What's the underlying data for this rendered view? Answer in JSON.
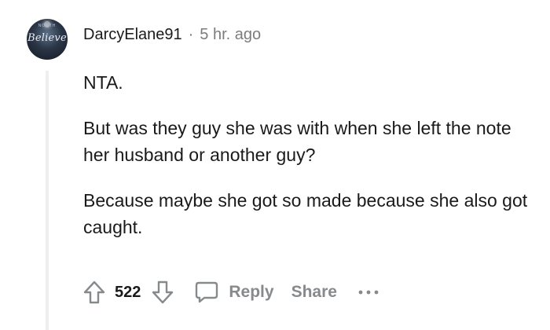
{
  "comment": {
    "avatar_text": "Believe",
    "avatar_top": "NORTH",
    "username": "DarcyElane91",
    "separator": "·",
    "time": "5 hr. ago",
    "paragraphs": [
      "NTA.",
      "But was they guy she was with when she left the note her husband or another guy?",
      "Because maybe she got so made because she also got caught."
    ]
  },
  "actions": {
    "upvote_icon": "arrow-up-outline-icon",
    "score": "522",
    "downvote_icon": "arrow-down-outline-icon",
    "comment_icon": "speech-bubble-icon",
    "reply_label": "Reply",
    "share_label": "Share",
    "more_icon": "ellipsis-icon"
  },
  "colors": {
    "text": "#1a1a1b",
    "muted": "#878a8c",
    "thread_line": "#edeff1"
  }
}
